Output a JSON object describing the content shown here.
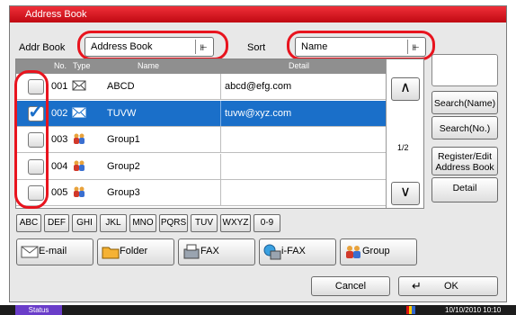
{
  "window": {
    "title": "Address Book"
  },
  "toolbar": {
    "addr_book_label": "Addr Book",
    "addr_book_value": "Address Book",
    "sort_label": "Sort",
    "sort_value": "Name"
  },
  "table": {
    "headers": {
      "no": "No.",
      "type": "Type",
      "name": "Name",
      "detail": "Detail"
    },
    "rows": [
      {
        "no": "001",
        "type": "envelope-icon",
        "name": "ABCD",
        "detail": "abcd@efg.com",
        "checked": false,
        "selected": false
      },
      {
        "no": "002",
        "type": "envelope-icon",
        "name": "TUVW",
        "detail": "tuvw@xyz.com",
        "checked": true,
        "selected": true
      },
      {
        "no": "003",
        "type": "group-icon",
        "name": "Group1",
        "detail": "",
        "checked": false,
        "selected": false
      },
      {
        "no": "004",
        "type": "group-icon",
        "name": "Group2",
        "detail": "",
        "checked": false,
        "selected": false
      },
      {
        "no": "005",
        "type": "group-icon",
        "name": "Group3",
        "detail": "",
        "checked": false,
        "selected": false
      }
    ]
  },
  "pager": {
    "page": "1/2"
  },
  "side": {
    "search_name": "Search(Name)",
    "search_no": "Search(No.)",
    "register_edit": "Register/Edit Address Book",
    "detail": "Detail"
  },
  "index_tabs": [
    "ABC",
    "DEF",
    "GHI",
    "JKL",
    "MNO",
    "PQRS",
    "TUV",
    "WXYZ",
    "0-9"
  ],
  "filters": {
    "email": "E-mail",
    "folder": "Folder",
    "fax": "FAX",
    "ifax": "i-FAX",
    "group": "Group"
  },
  "footer": {
    "cancel": "Cancel",
    "ok": "OK"
  },
  "statusbar": {
    "status": "Status",
    "datetime": "10/10/2010 10:10"
  },
  "colors": {
    "title": "#d7141f",
    "selection": "#1a6fc9",
    "highlight": "#e8141e",
    "status": "#6a3dc9"
  }
}
